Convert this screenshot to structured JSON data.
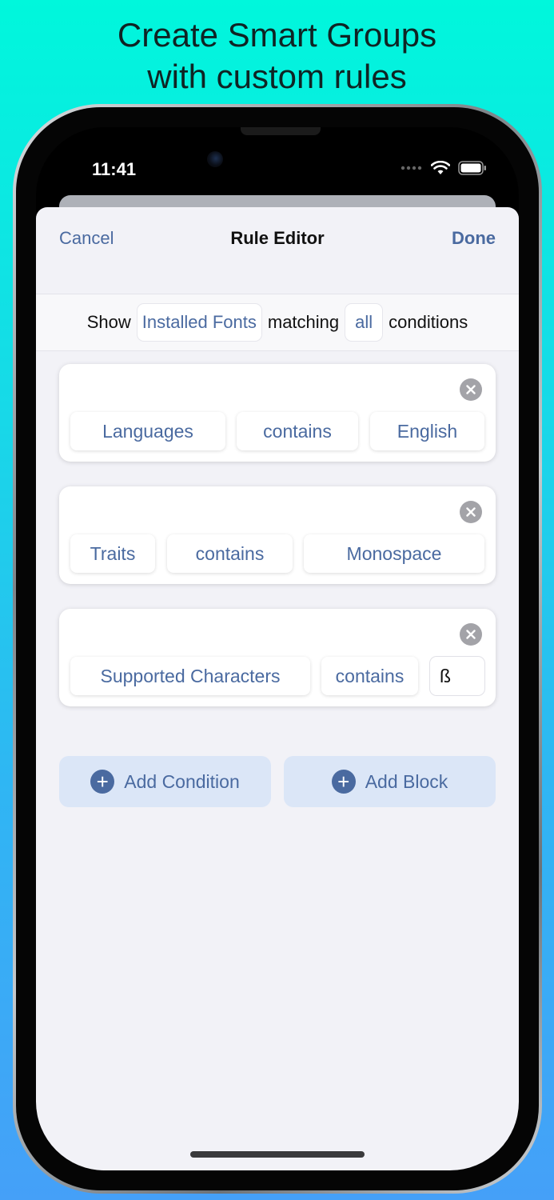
{
  "headline": {
    "line1": "Create Smart Groups",
    "line2": "with custom rules"
  },
  "status": {
    "time": "11:41"
  },
  "nav": {
    "cancel": "Cancel",
    "title": "Rule Editor",
    "done": "Done"
  },
  "rule": {
    "prefix": "Show",
    "scope": "Installed Fonts",
    "middle": "matching",
    "mode": "all",
    "suffix": "conditions"
  },
  "conditions": [
    {
      "field": "Languages",
      "operator": "contains",
      "value": "English"
    },
    {
      "field": "Traits",
      "operator": "contains",
      "value": "Monospace"
    },
    {
      "field": "Supported Characters",
      "operator": "contains",
      "value": "ß"
    }
  ],
  "actions": {
    "add_condition": "Add Condition",
    "add_block": "Add Block"
  },
  "colors": {
    "accent": "#4a6aa0",
    "sheet": "#f2f2f7",
    "button_bg": "#dbe6f7"
  }
}
